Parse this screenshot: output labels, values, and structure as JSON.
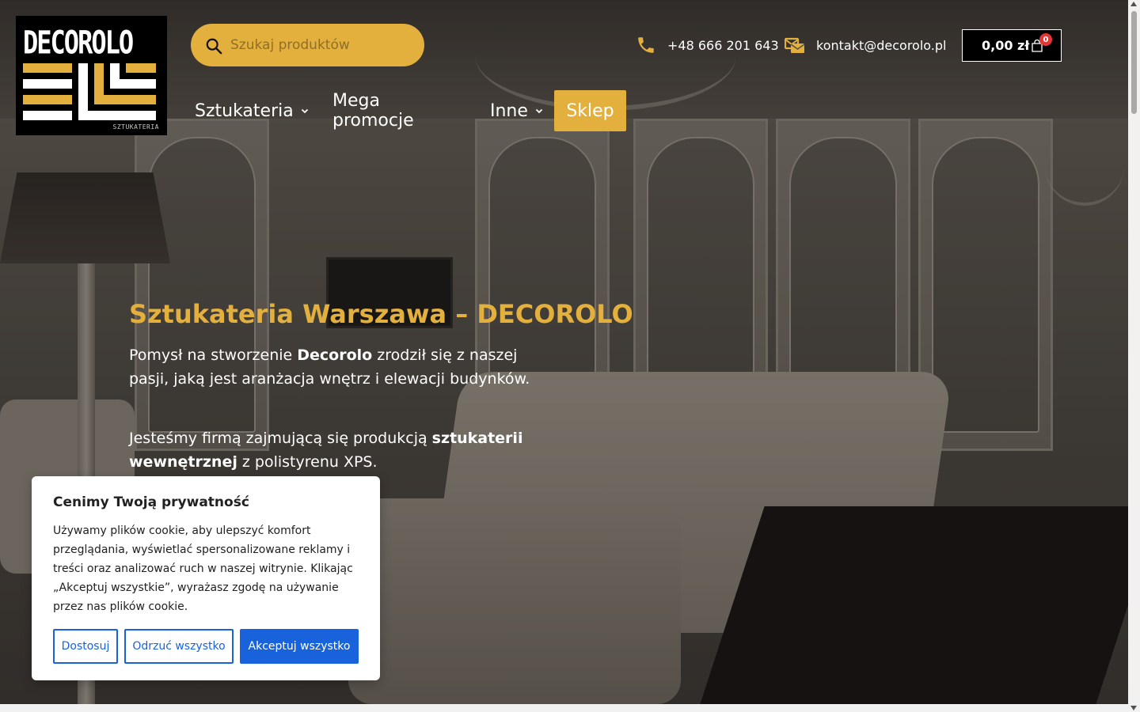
{
  "logo": {
    "brand": "DECOROLO",
    "sub": "SZTUKATERIA"
  },
  "search": {
    "placeholder": "Szukaj produktów"
  },
  "contact": {
    "phone": "+48 666 201 643",
    "email": "kontakt@decorolo.pl"
  },
  "cart": {
    "amount": "0,00 zł",
    "count": "0"
  },
  "nav": {
    "items": [
      {
        "label": "Sztukateria",
        "has_dropdown": true
      },
      {
        "label": "Mega promocje",
        "has_dropdown": false
      },
      {
        "label": "Inne",
        "has_dropdown": true
      },
      {
        "label": "Sklep",
        "highlighted": true
      }
    ]
  },
  "hero": {
    "title": "Sztukateria Warszawa – DECOROLO",
    "p1_before": "Pomysł na stworzenie ",
    "p1_bold": "Decorolo",
    "p1_after": " zrodził się z naszej pasji, jaką jest aranżacja wnętrz i elewacji budynków.",
    "p2_before": "Jesteśmy firmą zajmującą się produkcją ",
    "p2_bold": "sztukaterii wewnętrznej",
    "p2_after": " z polistyrenu XPS."
  },
  "cookie": {
    "title": "Cenimy Twoją prywatność",
    "text": "Używamy plików cookie, aby ulepszyć komfort przeglądania, wyświetlać spersonalizowane reklamy i treści oraz analizować ruch w naszej witrynie. Klikając „Akceptuj wszystkie”, wyrażasz zgodę na używanie przez nas plików cookie.",
    "buttons": {
      "customize": "Dostosuj",
      "reject": "Odrzuć wszystko",
      "accept": "Akceptuj wszystko"
    }
  },
  "colors": {
    "accent": "#e3b03e",
    "cookie_blue": "#1863dc",
    "badge": "#e63535"
  }
}
